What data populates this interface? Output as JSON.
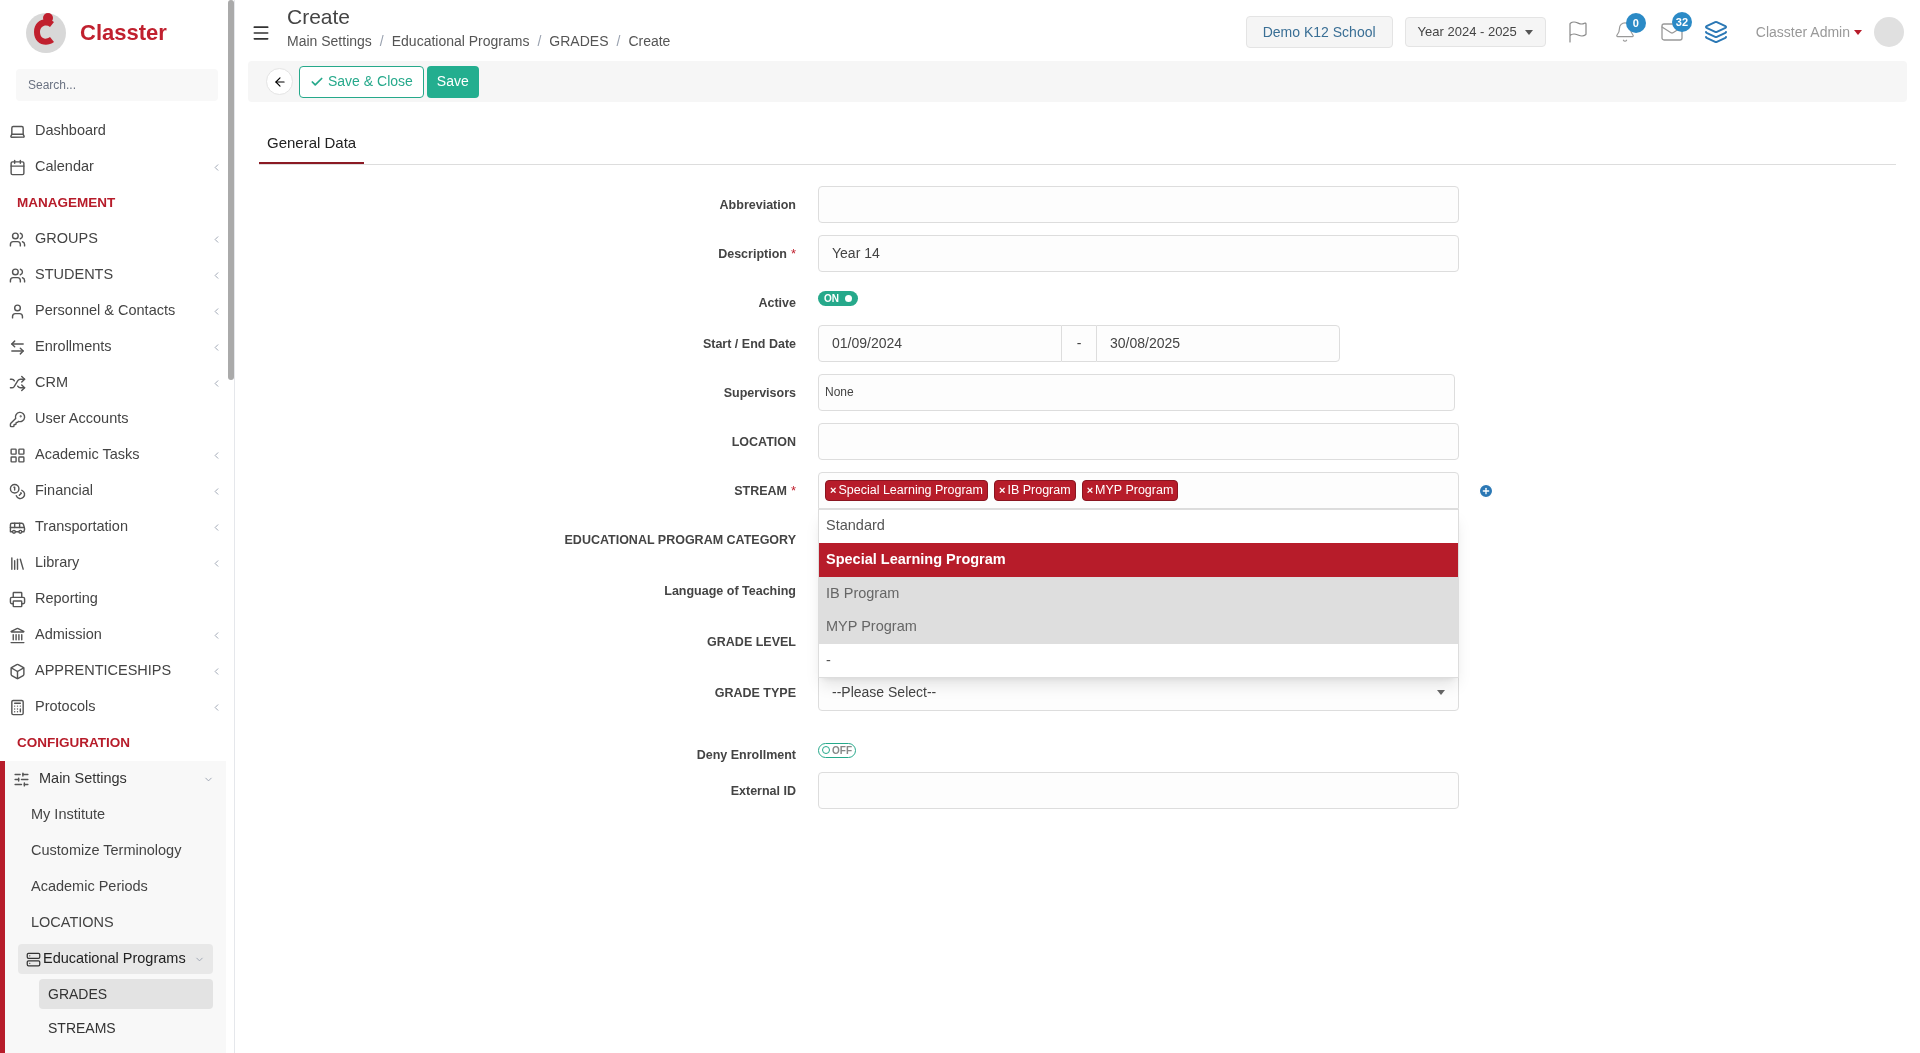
{
  "brand": {
    "name": "Classter"
  },
  "sidebar": {
    "search_placeholder": "Search...",
    "sections": [
      {
        "kind": "item",
        "label": "Dashboard",
        "chevron": false
      },
      {
        "kind": "item",
        "label": "Calendar",
        "chevron": true
      },
      {
        "kind": "heading",
        "label": "MANAGEMENT"
      },
      {
        "kind": "item",
        "label": "GROUPS",
        "chevron": true
      },
      {
        "kind": "item",
        "label": "STUDENTS",
        "chevron": true
      },
      {
        "kind": "item",
        "label": "Personnel & Contacts",
        "chevron": true
      },
      {
        "kind": "item",
        "label": "Enrollments",
        "chevron": true
      },
      {
        "kind": "item",
        "label": "CRM",
        "chevron": true
      },
      {
        "kind": "item",
        "label": "User Accounts",
        "chevron": false
      },
      {
        "kind": "item",
        "label": "Academic Tasks",
        "chevron": true
      },
      {
        "kind": "item",
        "label": "Financial",
        "chevron": true
      },
      {
        "kind": "item",
        "label": "Transportation",
        "chevron": true
      },
      {
        "kind": "item",
        "label": "Library",
        "chevron": true
      },
      {
        "kind": "item",
        "label": "Reporting",
        "chevron": false
      },
      {
        "kind": "item",
        "label": "Admission",
        "chevron": true
      },
      {
        "kind": "item",
        "label": "APPRENTICESHIPS",
        "chevron": true
      },
      {
        "kind": "item",
        "label": "Protocols",
        "chevron": true
      },
      {
        "kind": "heading",
        "label": "CONFIGURATION"
      }
    ],
    "tree": {
      "label": "Main Settings",
      "expanded": true,
      "children": [
        {
          "label": "My Institute",
          "selected": false
        },
        {
          "label": "Customize Terminology",
          "selected": false
        },
        {
          "label": "Academic Periods",
          "selected": false
        },
        {
          "label": "LOCATIONS",
          "selected": false
        },
        {
          "label": "Educational Programs",
          "expanded": true,
          "selected": false,
          "children": [
            {
              "label": "GRADES",
              "selected": true
            },
            {
              "label": "STREAMS",
              "selected": false
            }
          ]
        }
      ]
    }
  },
  "header": {
    "title": "Create",
    "breadcrumbs": [
      {
        "label": "Main Settings",
        "sep": "/"
      },
      {
        "label": "Educational Programs",
        "sep": "/"
      },
      {
        "label": "GRADES",
        "sep": "/"
      },
      {
        "label": "Create"
      }
    ],
    "school": "Demo K12 School",
    "year": "Year 2024 - 2025",
    "notifications": "0",
    "messages": "32",
    "user": "Classter Admin"
  },
  "toolbar": {
    "save_close": "Save & Close",
    "save": "Save"
  },
  "tabs": [
    {
      "label": "General Data",
      "selected": true
    }
  ],
  "form": [
    {
      "kind": "text",
      "label": "Abbreviation"
    },
    {
      "kind": "text",
      "label": "Description",
      "required_mark": "*",
      "value": "Year 14"
    },
    {
      "kind": "toggle",
      "label": "Active",
      "on": true,
      "text": "ON"
    },
    {
      "kind": "daterange",
      "label": "Start / End Date",
      "from": "01/09/2024",
      "sep": "-",
      "to": "30/08/2025"
    },
    {
      "kind": "multiselect",
      "label": "Supervisors",
      "value": "None"
    },
    {
      "kind": "text",
      "label": "LOCATION"
    },
    {
      "kind": "tags",
      "label": "STREAM",
      "required_mark": "*",
      "tags": [
        {
          "label": "Special Learning Program",
          "remove": "×"
        },
        {
          "label": "IB Program",
          "remove": "×"
        },
        {
          "label": "MYP Program",
          "remove": "×"
        }
      ],
      "options": [
        {
          "label": "Standard",
          "highlighted": false,
          "chosen": false
        },
        {
          "label": "Special Learning Program",
          "highlighted": true,
          "chosen": true
        },
        {
          "label": "IB Program",
          "highlighted": false,
          "chosen": true
        },
        {
          "label": "MYP Program",
          "highlighted": false,
          "chosen": true
        },
        {
          "label": "-",
          "highlighted": false,
          "chosen": false
        }
      ]
    },
    {
      "kind": "hidden",
      "label": "EDUCATIONAL PROGRAM CATEGORY"
    },
    {
      "kind": "hidden",
      "label": "Language of Teaching"
    },
    {
      "kind": "hidden",
      "label": "GRADE LEVEL"
    },
    {
      "kind": "select",
      "label": "GRADE TYPE",
      "value": "--Please Select--"
    },
    {
      "kind": "toggle",
      "label": "Deny Enrollment",
      "on": false,
      "text": "OFF"
    },
    {
      "kind": "text",
      "label": "External ID"
    }
  ]
}
